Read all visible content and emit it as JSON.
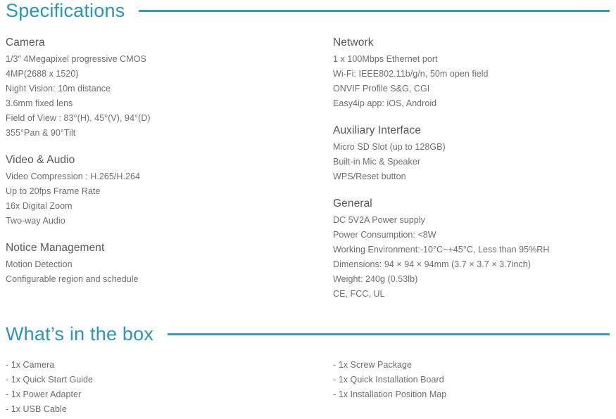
{
  "sections": {
    "specifications": {
      "title": "Specifications",
      "rule_color": "#3a9cb0",
      "title_color": "#2e93bd",
      "left_column": [
        {
          "heading": "Camera",
          "lines": [
            "1/3″ 4Megapixel progressive CMOS",
            "4MP(2688 x 1520)",
            "Night Vision: 10m distance",
            "3.6mm fixed lens",
            "Field of View : 83°(H), 45°(V), 94°(D)",
            "355°Pan & 90°Tilt"
          ]
        },
        {
          "heading": "Video & Audio",
          "lines": [
            "Video Compression : H.265/H.264",
            "Up to 20fps Frame Rate",
            "16x Digital Zoom",
            "Two-way Audio"
          ]
        },
        {
          "heading": "Notice Management",
          "lines": [
            "Motion Detection",
            "Configurable region and schedule"
          ]
        }
      ],
      "right_column": [
        {
          "heading": "Network",
          "lines": [
            "1 x 100Mbps Ethernet port",
            "Wi-Fi: IEEE802.11b/g/n, 50m open field",
            "ONVIF Profile S&G, CGI",
            "Easy4ip app: iOS, Android"
          ]
        },
        {
          "heading": "Auxiliary Interface",
          "lines": [
            "Micro SD Slot (up to 128GB)",
            "Built-in Mic & Speaker",
            "WPS/Reset button"
          ]
        },
        {
          "heading": "General",
          "lines": [
            "DC 5V2A Power supply",
            "Power Consumption: <8W",
            "Working Environment:-10°C~+45°C, Less than 95%RH",
            "Dimensions: 94 × 94 × 94mm (3.7 × 3.7 × 3.7inch)",
            "Weight: 240g (0.53lb)",
            "CE, FCC, UL"
          ]
        }
      ]
    },
    "whats_in_the_box": {
      "title": "What’s in the box",
      "left_column": [
        "- 1x Camera",
        "- 1x Quick Start Guide",
        "- 1x Power Adapter",
        "- 1x USB Cable"
      ],
      "right_column": [
        "- 1x Screw Package",
        "- 1x Quick Installation Board",
        "- 1x Installation Position Map"
      ]
    }
  }
}
